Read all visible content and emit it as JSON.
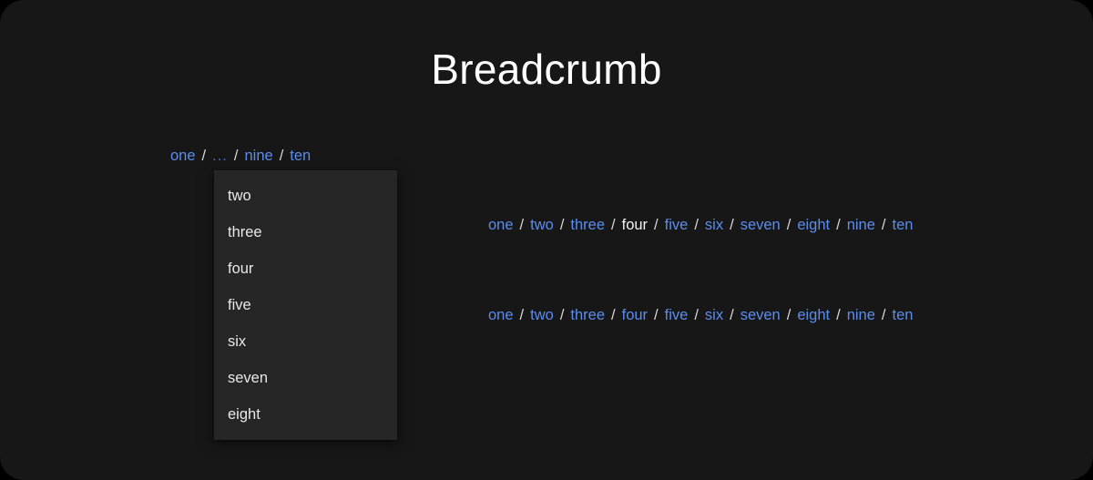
{
  "page": {
    "title": "Breadcrumb",
    "background": "#171717",
    "link_color": "#5b8dee",
    "current_color": "#f2f2f2",
    "separator_color": "#d8d8d8",
    "menu_background": "#262626"
  },
  "separator": "/",
  "collapsed_breadcrumb": {
    "items": [
      {
        "label": "one",
        "type": "link"
      },
      {
        "label": "...",
        "type": "ellipsis"
      },
      {
        "label": "nine",
        "type": "link"
      },
      {
        "label": "ten",
        "type": "link"
      }
    ]
  },
  "dropdown_menu": {
    "items": [
      {
        "label": "two"
      },
      {
        "label": "three"
      },
      {
        "label": "four"
      },
      {
        "label": "five"
      },
      {
        "label": "six"
      },
      {
        "label": "seven"
      },
      {
        "label": "eight"
      }
    ]
  },
  "breadcrumb_with_current": {
    "items": [
      {
        "label": "one",
        "type": "link"
      },
      {
        "label": "two",
        "type": "link"
      },
      {
        "label": "three",
        "type": "link"
      },
      {
        "label": "four",
        "type": "current"
      },
      {
        "label": "five",
        "type": "link"
      },
      {
        "label": "six",
        "type": "link"
      },
      {
        "label": "seven",
        "type": "link"
      },
      {
        "label": "eight",
        "type": "link"
      },
      {
        "label": "nine",
        "type": "link"
      },
      {
        "label": "ten",
        "type": "link"
      }
    ]
  },
  "breadcrumb_all_links": {
    "items": [
      {
        "label": "one",
        "type": "link"
      },
      {
        "label": "two",
        "type": "link"
      },
      {
        "label": "three",
        "type": "link"
      },
      {
        "label": "four",
        "type": "link"
      },
      {
        "label": "five",
        "type": "link"
      },
      {
        "label": "six",
        "type": "link"
      },
      {
        "label": "seven",
        "type": "link"
      },
      {
        "label": "eight",
        "type": "link"
      },
      {
        "label": "nine",
        "type": "link"
      },
      {
        "label": "ten",
        "type": "link"
      }
    ]
  }
}
